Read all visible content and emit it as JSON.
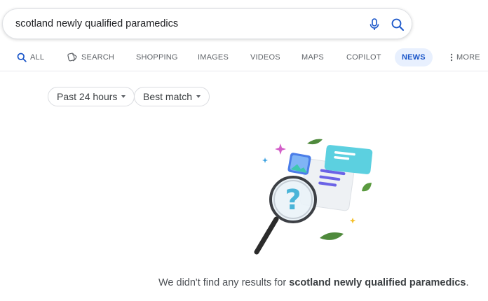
{
  "search": {
    "query": "scotland newly qualified paramedics"
  },
  "tabs": [
    {
      "label": "ALL"
    },
    {
      "label": "SEARCH"
    },
    {
      "label": "SHOPPING"
    },
    {
      "label": "IMAGES"
    },
    {
      "label": "VIDEOS"
    },
    {
      "label": "MAPS"
    },
    {
      "label": "COPILOT"
    },
    {
      "label": "NEWS"
    },
    {
      "label": "MORE"
    }
  ],
  "filters": {
    "time": "Past 24 hours",
    "sort": "Best match"
  },
  "empty_state": {
    "prefix": "We didn't find any results for ",
    "query": "scotland newly qualified paramedics",
    "suffix": "."
  },
  "colors": {
    "accent": "#1a56c9",
    "active_tab_bg": "#e8f0fe"
  }
}
